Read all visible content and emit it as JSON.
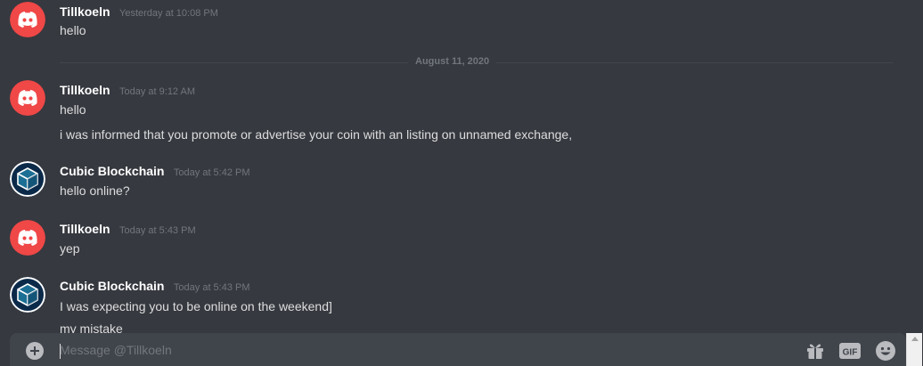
{
  "messages": [
    {
      "author": "Tillkoeln",
      "avatar": "discord-logo-icon",
      "avatar_color": "#f04747",
      "time": "Yesterday at 10:08 PM",
      "lines": [
        "hello"
      ]
    },
    {
      "author": "Tillkoeln",
      "avatar": "discord-logo-icon",
      "avatar_color": "#f04747",
      "time": "Today at 9:12 AM",
      "lines": [
        "hello",
        "i was informed that you promote or advertise your coin with an listing on unnamed exchange,"
      ]
    },
    {
      "author": "Cubic Blockchain",
      "avatar": "cube-logo-icon",
      "avatar_color": "#0b2a4a",
      "time": "Today at 5:42 PM",
      "lines": [
        "hello online?"
      ]
    },
    {
      "author": "Tillkoeln",
      "avatar": "discord-logo-icon",
      "avatar_color": "#f04747",
      "time": "Today at 5:43 PM",
      "lines": [
        "yep"
      ]
    },
    {
      "author": "Cubic Blockchain",
      "avatar": "cube-logo-icon",
      "avatar_color": "#0b2a4a",
      "time": "Today at 5:43 PM",
      "lines": [
        "I was expecting you to be online on the weekend]",
        "my mistake"
      ]
    }
  ],
  "divider": {
    "label": "August 11, 2020"
  },
  "composer": {
    "placeholder": "Message @Tillkoeln",
    "value": "",
    "buttons": [
      "add-attachment-icon",
      "gift-icon",
      "gif-icon",
      "emoji-icon"
    ],
    "gif_label": "GIF"
  },
  "colors": {
    "background": "#36393f",
    "composer": "#40444b",
    "username": "#ffffff",
    "text": "#dcddde",
    "muted": "#72767d"
  }
}
